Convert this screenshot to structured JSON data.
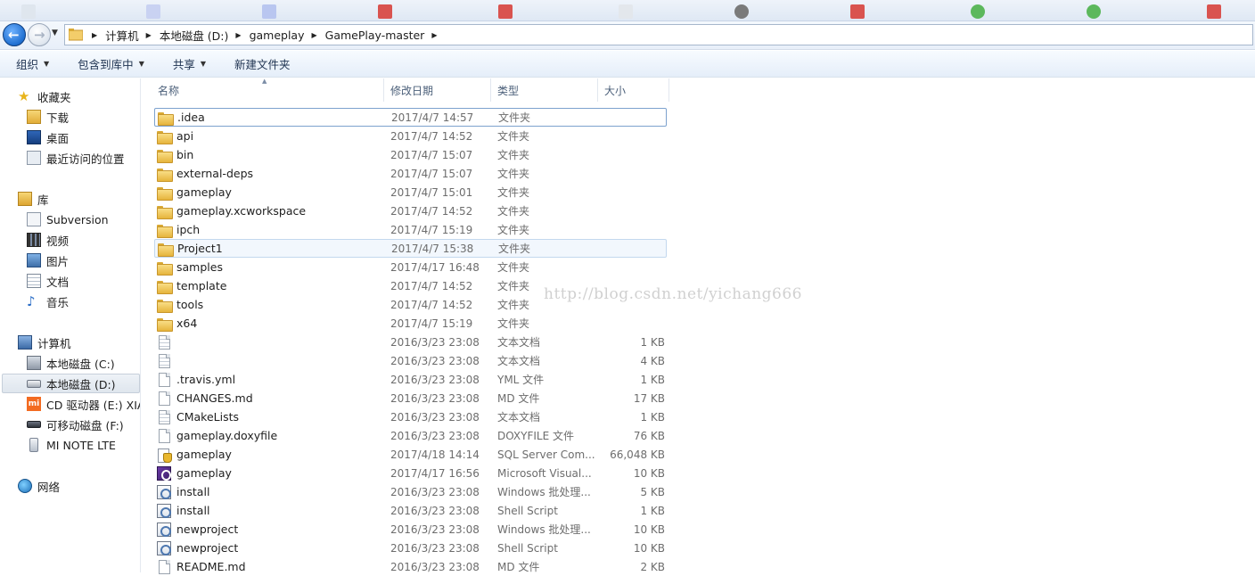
{
  "breadcrumbs": [
    "计算机",
    "本地磁盘 (D:)",
    "gameplay",
    "GamePlay-master"
  ],
  "toolbar": {
    "organize": "组织",
    "include_library": "包含到库中",
    "share": "共享",
    "new_folder": "新建文件夹"
  },
  "sidebar": {
    "favorites": "收藏夹",
    "downloads": "下载",
    "desktop": "桌面",
    "recent": "最近访问的位置",
    "libraries": "库",
    "subversion": "Subversion",
    "videos": "视频",
    "pictures": "图片",
    "documents": "文档",
    "music": "音乐",
    "computer": "计算机",
    "drive_c": "本地磁盘 (C:)",
    "drive_d": "本地磁盘 (D:)",
    "drive_e": "CD 驱动器 (E:) XIAOMI",
    "drive_f": "可移动磁盘 (F:)",
    "device": "MI NOTE LTE",
    "network": "网络"
  },
  "columns": {
    "name": "名称",
    "date": "修改日期",
    "type": "类型",
    "size": "大小"
  },
  "files": [
    {
      "name": ".idea",
      "date": "2017/4/7 14:57",
      "type": "文件夹",
      "size": "",
      "icon": "folder-icon"
    },
    {
      "name": "api",
      "date": "2017/4/7 14:52",
      "type": "文件夹",
      "size": "",
      "icon": "folder-icon"
    },
    {
      "name": "bin",
      "date": "2017/4/7 15:07",
      "type": "文件夹",
      "size": "",
      "icon": "folder-icon"
    },
    {
      "name": "external-deps",
      "date": "2017/4/7 15:07",
      "type": "文件夹",
      "size": "",
      "icon": "folder-icon"
    },
    {
      "name": "gameplay",
      "date": "2017/4/7 15:01",
      "type": "文件夹",
      "size": "",
      "icon": "folder-icon"
    },
    {
      "name": "gameplay.xcworkspace",
      "date": "2017/4/7 14:52",
      "type": "文件夹",
      "size": "",
      "icon": "folder-icon"
    },
    {
      "name": "ipch",
      "date": "2017/4/7 15:19",
      "type": "文件夹",
      "size": "",
      "icon": "folder-icon"
    },
    {
      "name": "Project1",
      "date": "2017/4/7 15:38",
      "type": "文件夹",
      "size": "",
      "icon": "folder-icon"
    },
    {
      "name": "samples",
      "date": "2017/4/17 16:48",
      "type": "文件夹",
      "size": "",
      "icon": "folder-icon"
    },
    {
      "name": "template",
      "date": "2017/4/7 14:52",
      "type": "文件夹",
      "size": "",
      "icon": "folder-icon"
    },
    {
      "name": "tools",
      "date": "2017/4/7 14:52",
      "type": "文件夹",
      "size": "",
      "icon": "folder-icon"
    },
    {
      "name": "x64",
      "date": "2017/4/7 15:19",
      "type": "文件夹",
      "size": "",
      "icon": "folder-icon"
    },
    {
      "name": "",
      "date": "2016/3/23 23:08",
      "type": "文本文档",
      "size": "1 KB",
      "icon": "text-document-icon"
    },
    {
      "name": "",
      "date": "2016/3/23 23:08",
      "type": "文本文档",
      "size": "4 KB",
      "icon": "text-document-icon"
    },
    {
      "name": ".travis.yml",
      "date": "2016/3/23 23:08",
      "type": "YML 文件",
      "size": "1 KB",
      "icon": "file-icon"
    },
    {
      "name": "CHANGES.md",
      "date": "2016/3/23 23:08",
      "type": "MD 文件",
      "size": "17 KB",
      "icon": "file-icon"
    },
    {
      "name": "CMakeLists",
      "date": "2016/3/23 23:08",
      "type": "文本文档",
      "size": "1 KB",
      "icon": "text-document-icon"
    },
    {
      "name": "gameplay.doxyfile",
      "date": "2016/3/23 23:08",
      "type": "DOXYFILE 文件",
      "size": "76 KB",
      "icon": "file-icon"
    },
    {
      "name": "gameplay",
      "date": "2017/4/18 14:14",
      "type": "SQL Server Com...",
      "size": "66,048 KB",
      "icon": "sql-database-icon"
    },
    {
      "name": "gameplay",
      "date": "2017/4/17 16:56",
      "type": "Microsoft Visual...",
      "size": "10 KB",
      "icon": "visual-studio-solution-icon"
    },
    {
      "name": "install",
      "date": "2016/3/23 23:08",
      "type": "Windows 批处理...",
      "size": "5 KB",
      "icon": "script-icon"
    },
    {
      "name": "install",
      "date": "2016/3/23 23:08",
      "type": "Shell Script",
      "size": "1 KB",
      "icon": "script-icon"
    },
    {
      "name": "newproject",
      "date": "2016/3/23 23:08",
      "type": "Windows 批处理...",
      "size": "10 KB",
      "icon": "script-icon"
    },
    {
      "name": "newproject",
      "date": "2016/3/23 23:08",
      "type": "Shell Script",
      "size": "10 KB",
      "icon": "script-icon"
    },
    {
      "name": "README.md",
      "date": "2016/3/23 23:08",
      "type": "MD 文件",
      "size": "2 KB",
      "icon": "file-icon"
    }
  ],
  "watermark": "http://blog.csdn.net/yichang666"
}
